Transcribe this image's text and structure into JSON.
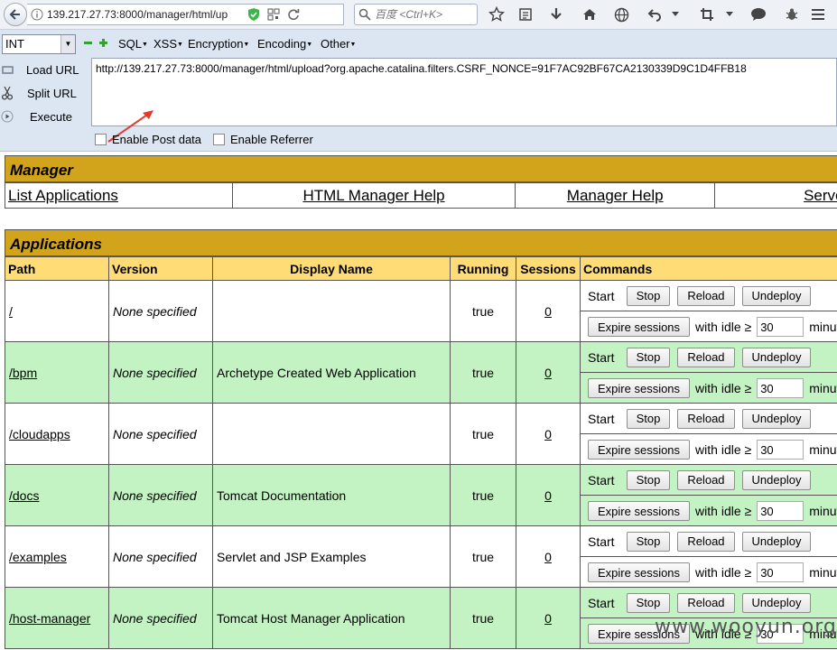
{
  "browser": {
    "url_display": "139.217.27.73:8000/manager/html/up",
    "search_placeholder": "百度 <Ctrl+K>"
  },
  "hackbar": {
    "select_value": "INT",
    "menus": [
      "SQL",
      "XSS",
      "Encryption",
      "Encoding",
      "Other"
    ],
    "actions": {
      "load": "Load URL",
      "split": "Split URL",
      "execute": "Execute"
    },
    "url_value": "http://139.217.27.73:8000/manager/html/upload?org.apache.catalina.filters.CSRF_NONCE=91F7AC92BF67CA2130339D9C1D4FFB18",
    "enable_post": "Enable Post data",
    "enable_referrer": "Enable Referrer"
  },
  "manager": {
    "title": "Manager",
    "links": [
      "List Applications",
      "HTML Manager Help",
      "Manager Help",
      "Server Status"
    ]
  },
  "applications": {
    "title": "Applications",
    "headers": [
      "Path",
      "Version",
      "Display Name",
      "Running",
      "Sessions",
      "Commands"
    ],
    "rows": [
      {
        "path": "/",
        "version": "None specified",
        "display": "",
        "running": "true",
        "sessions": "0"
      },
      {
        "path": "/bpm",
        "version": "None specified",
        "display": "Archetype Created Web Application",
        "running": "true",
        "sessions": "0"
      },
      {
        "path": "/cloudapps",
        "version": "None specified",
        "display": "",
        "running": "true",
        "sessions": "0"
      },
      {
        "path": "/docs",
        "version": "None specified",
        "display": "Tomcat Documentation",
        "running": "true",
        "sessions": "0"
      },
      {
        "path": "/examples",
        "version": "None specified",
        "display": "Servlet and JSP Examples",
        "running": "true",
        "sessions": "0"
      },
      {
        "path": "/host-manager",
        "version": "None specified",
        "display": "Tomcat Host Manager Application",
        "running": "true",
        "sessions": "0"
      }
    ],
    "commands": {
      "start": "Start",
      "stop": "Stop",
      "reload": "Reload",
      "undeploy": "Undeploy",
      "expire": "Expire sessions",
      "idle_label": "with idle ≥",
      "idle_value": "30",
      "minutes": "minutes"
    }
  },
  "watermark": "www.wooyun.org",
  "colors": {
    "section_header": "#d2a41c",
    "table_header": "#ffdc75",
    "row_green": "#c3f3c3"
  }
}
